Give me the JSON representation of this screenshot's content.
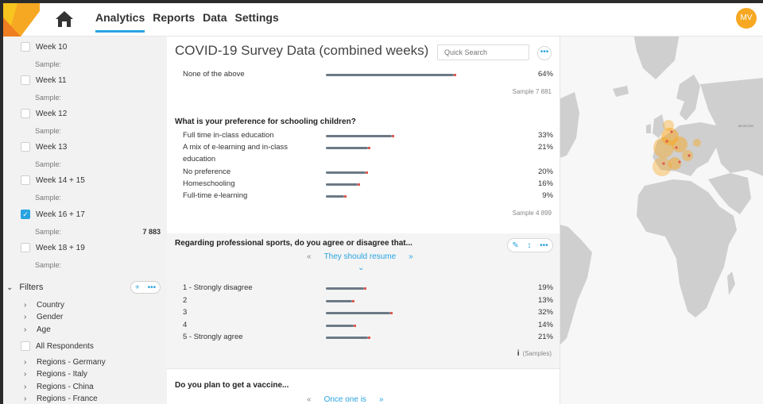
{
  "nav": {
    "items": [
      "Analytics",
      "Reports",
      "Data",
      "Settings"
    ],
    "active": "Analytics"
  },
  "user": {
    "initials": "MV"
  },
  "sidebar": {
    "weeks": [
      {
        "label": "Week 10",
        "sample_label": "Sample:",
        "sample_value": "",
        "checked": false
      },
      {
        "label": "Week 11",
        "sample_label": "Sample:",
        "sample_value": "",
        "checked": false
      },
      {
        "label": "Week 12",
        "sample_label": "Sample:",
        "sample_value": "",
        "checked": false
      },
      {
        "label": "Week 13",
        "sample_label": "Sample:",
        "sample_value": "",
        "checked": false
      },
      {
        "label": "Week 14 + 15",
        "sample_label": "Sample:",
        "sample_value": "",
        "checked": false
      },
      {
        "label": "Week 16 + 17",
        "sample_label": "Sample:",
        "sample_value": "7 883",
        "checked": true
      },
      {
        "label": "Week 18 + 19",
        "sample_label": "Sample:",
        "sample_value": "",
        "checked": false
      }
    ],
    "filters_label": "Filters",
    "filter_items": [
      "Country",
      "Gender",
      "Age"
    ],
    "all_respondents": "All Respondents",
    "regions": [
      "Regions - Germany",
      "Regions - Italy",
      "Regions - China",
      "Regions - France"
    ]
  },
  "main": {
    "title": "COVID-19 Survey Data (combined weeks)",
    "search_placeholder": "Quick Search",
    "q1_partial": {
      "rows": [
        {
          "label": "None of the above",
          "pct": "64%",
          "value": 64
        }
      ],
      "sample": "Sample 7 881"
    },
    "q2": {
      "question": "What is your preference for schooling children?",
      "rows": [
        {
          "label": "Full time in-class education",
          "pct": "33%",
          "value": 33
        },
        {
          "label": "A mix of e-learning and in-class",
          "label2": "education",
          "pct": "21%",
          "value": 21
        },
        {
          "label": "No preference",
          "pct": "20%",
          "value": 20
        },
        {
          "label": "Homeschooling",
          "pct": "16%",
          "value": 16
        },
        {
          "label": "Full-time e-learning",
          "pct": "9%",
          "value": 9
        }
      ],
      "sample": "Sample 4 899"
    },
    "q3": {
      "question": "Regarding professional sports, do you agree or disagree that...",
      "selector": "They should resume",
      "rows": [
        {
          "label": "1 - Strongly disagree",
          "pct": "19%",
          "value": 19
        },
        {
          "label": "2",
          "pct": "13%",
          "value": 13
        },
        {
          "label": "3",
          "pct": "32%",
          "value": 32
        },
        {
          "label": "4",
          "pct": "14%",
          "value": 14
        },
        {
          "label": "5 - Strongly agree",
          "pct": "21%",
          "value": 21
        }
      ],
      "samples_link": "(Samples)"
    },
    "q4": {
      "question": "Do you plan to get a vaccine...",
      "selector": "Once one is"
    }
  },
  "map": {
    "labels": [
      "MOSCOW"
    ],
    "colors": {
      "land": "#cfcfcf",
      "water": "#f7f7f7",
      "heat": "#f7a823",
      "accent": "#29a3e0"
    }
  }
}
